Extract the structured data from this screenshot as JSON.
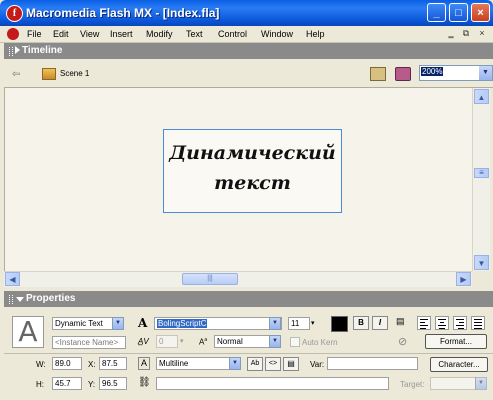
{
  "window": {
    "title": "Macromedia Flash MX - [Index.fla]",
    "app_icon_glyph": "f",
    "controls": {
      "minimize": "_",
      "maximize": "□",
      "close": "×"
    }
  },
  "menu": {
    "items": [
      "File",
      "Edit",
      "View",
      "Insert",
      "Modify",
      "Text",
      "Control",
      "Window",
      "Help"
    ]
  },
  "timeline": {
    "label": "Timeline"
  },
  "scene": {
    "label": "Scene 1",
    "zoom": "200%"
  },
  "stage": {
    "text_line1": "Динамический",
    "text_line2": "текст"
  },
  "properties": {
    "label": "Properties",
    "text_type": "Dynamic Text",
    "instance_name_placeholder": "<Instance Name>",
    "font": "BolingScriptC",
    "font_size": "11",
    "bold": "B",
    "italic": "I",
    "tracking": "0",
    "baseline": "Normal",
    "auto_kern": "Auto Kern",
    "format_button": "Format...",
    "width_label": "W:",
    "width": "89.0",
    "height_label": "H:",
    "height": "45.7",
    "x_label": "X:",
    "x": "87.5",
    "y_label": "Y:",
    "y": "96.5",
    "line_type": "Multiline",
    "var_label": "Var:",
    "character_button": "Character...",
    "target_label": "Target:"
  },
  "colors": {
    "accent": "#0a5ee4",
    "panel_header": "#8a8a8a",
    "text_color_swatch": "#000000",
    "stage_bg": "#f6f3eb"
  }
}
